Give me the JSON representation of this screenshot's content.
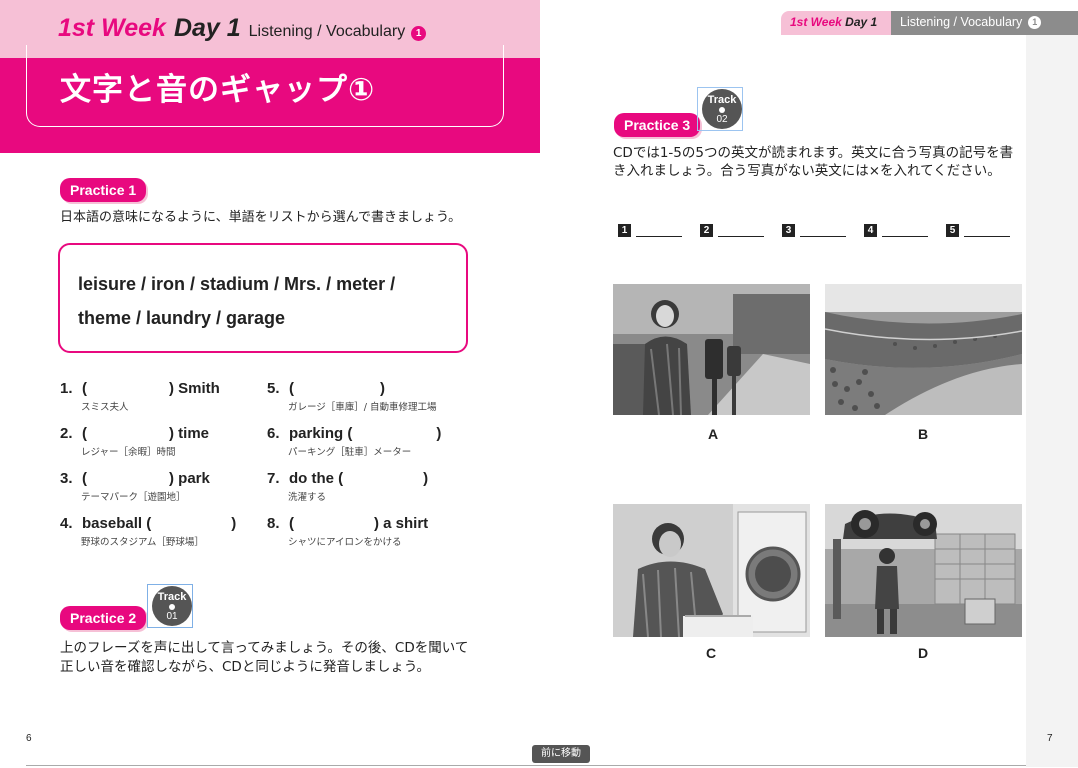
{
  "left_page": {
    "header": {
      "week": "1st Week",
      "day": "Day 1",
      "section": "Listening / Vocabulary",
      "section_num": "1",
      "title": "文字と音のギャップ①"
    },
    "practice1": {
      "tag": "Practice 1",
      "instruction": "日本語の意味になるように、単語をリストから選んで書きましょう。",
      "word_list": [
        "leisure  /  iron  /  stadium  /  Mrs.  /  meter  /",
        "theme  /  laundry  /  garage"
      ],
      "items": [
        {
          "num": "1.",
          "pre": "(",
          "post": ")  Smith",
          "hint": "スミス夫人"
        },
        {
          "num": "2.",
          "pre": "(",
          "post": ")  time",
          "hint": "レジャー［余暇］時間"
        },
        {
          "num": "3.",
          "pre": "(",
          "post": ")  park",
          "hint": "テーマパーク［遊園地］"
        },
        {
          "num": "4.",
          "pre": "baseball  (",
          "post": ")",
          "hint": "野球のスタジアム［野球場］"
        },
        {
          "num": "5.",
          "pre": "(",
          "post": ")",
          "hint": "ガレージ［車庫］/ 自動車修理工場"
        },
        {
          "num": "6.",
          "pre": "parking  (",
          "post": ")",
          "hint": "パーキング［駐車］メーター"
        },
        {
          "num": "7.",
          "pre": "do the  (",
          "post": ")",
          "hint": "洗濯する"
        },
        {
          "num": "8.",
          "pre": " (",
          "post": ")  a shirt",
          "hint": "シャツにアイロンをかける"
        }
      ]
    },
    "practice2": {
      "tag": "Practice 2",
      "track_label": "Track",
      "track_num": "01",
      "instruction": [
        "上のフレーズを声に出して言ってみましょう。その後、CDを聞いて",
        "正しい音を確認しながら、CDと同じように発音しましょう。"
      ]
    },
    "page_number": "6"
  },
  "right_page": {
    "header": {
      "week": "1st Week",
      "day": "Day 1",
      "section": "Listening / Vocabulary",
      "section_num": "1"
    },
    "practice3": {
      "tag": "Practice 3",
      "track_label": "Track",
      "track_num": "02",
      "instruction": [
        "CDでは1-5の5つの英文が読まれます。英文に合う写真の記号を書",
        "き入れましょう。合う写真がない英文には×を入れてください。"
      ],
      "blanks": [
        "1",
        "2",
        "3",
        "4",
        "5"
      ],
      "photos": [
        {
          "label": "A",
          "subject": "woman at parking meter"
        },
        {
          "label": "B",
          "subject": "crowded baseball stadium"
        },
        {
          "label": "C",
          "subject": "man at washing machine"
        },
        {
          "label": "D",
          "subject": "mechanic in car repair garage"
        }
      ]
    },
    "page_number": "7"
  },
  "nav": {
    "prev_label": "前に移動"
  },
  "colors": {
    "accent": "#e8097f",
    "accent_light": "#f6c0d6",
    "gray_tab": "#8c8c8c"
  }
}
